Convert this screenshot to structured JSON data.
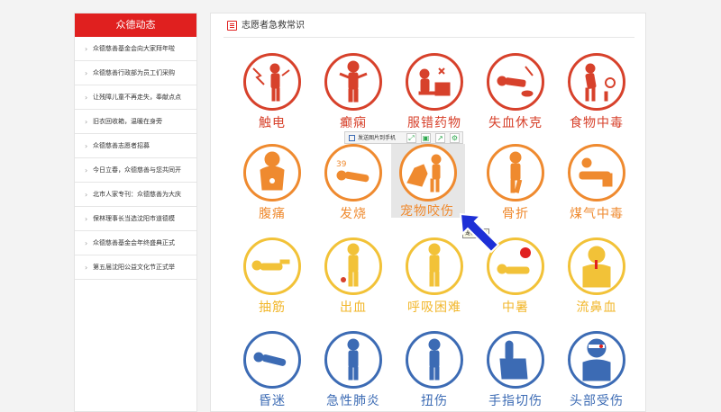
{
  "sidebar": {
    "title": "众德动态",
    "items": [
      {
        "label": "众德慈善基金会向大家拜年啦"
      },
      {
        "label": "众德慈善行政部为员工们采购"
      },
      {
        "label": "让残障儿童不再走失，奉献点点"
      },
      {
        "label": "旧衣回收箱，温暖在身旁"
      },
      {
        "label": "众德慈善志愿者招募"
      },
      {
        "label": "今日立春，众德慈善与您共同开"
      },
      {
        "label": "北市人家专刊：众德慈善为大庆"
      },
      {
        "label": "保林理事长当选沈阳市道德模"
      },
      {
        "label": "众德慈善基金会年终盛典正式"
      },
      {
        "label": "第五届沈阳公益文化节正式举"
      }
    ]
  },
  "main": {
    "title": "志愿者急救常识",
    "tiles": [
      {
        "label": "触电",
        "color": "#d7412b",
        "icon": "electric-shock-icon"
      },
      {
        "label": "癫痫",
        "color": "#d7412b",
        "icon": "epilepsy-icon"
      },
      {
        "label": "服错药物",
        "color": "#d7412b",
        "icon": "wrong-medicine-icon"
      },
      {
        "label": "失血休克",
        "color": "#d7412b",
        "icon": "blood-loss-shock-icon"
      },
      {
        "label": "食物中毒",
        "color": "#d7412b",
        "icon": "food-poisoning-icon"
      },
      {
        "label": "腹痛",
        "color": "#ef8a2f",
        "icon": "abdominal-pain-icon"
      },
      {
        "label": "发烧",
        "color": "#ef8a2f",
        "icon": "fever-icon"
      },
      {
        "label": "宠物咬伤",
        "color": "#ef8a2f",
        "icon": "pet-bite-icon"
      },
      {
        "label": "骨折",
        "color": "#ef8a2f",
        "icon": "fracture-icon"
      },
      {
        "label": "煤气中毒",
        "color": "#ef8a2f",
        "icon": "gas-poisoning-icon"
      },
      {
        "label": "抽筋",
        "color": "#f2c238",
        "icon": "cramp-icon"
      },
      {
        "label": "出血",
        "color": "#f2c238",
        "icon": "bleeding-icon"
      },
      {
        "label": "呼吸困难",
        "color": "#f2c238",
        "icon": "breathing-difficulty-icon"
      },
      {
        "label": "中暑",
        "color": "#f2c238",
        "icon": "heatstroke-icon"
      },
      {
        "label": "流鼻血",
        "color": "#f2c238",
        "icon": "nosebleed-icon"
      },
      {
        "label": "昏迷",
        "color": "#3c6bb4",
        "icon": "coma-icon"
      },
      {
        "label": "急性肺炎",
        "color": "#3c6bb4",
        "icon": "acute-pneumonia-icon"
      },
      {
        "label": "扭伤",
        "color": "#3c6bb4",
        "icon": "sprain-icon"
      },
      {
        "label": "手指切伤",
        "color": "#3c6bb4",
        "icon": "finger-cut-icon"
      },
      {
        "label": "头部受伤",
        "color": "#3c6bb4",
        "icon": "head-injury-icon"
      }
    ]
  },
  "fever_badge": "39",
  "toolbar": {
    "send_label": "发送图片到手机",
    "buttons": [
      "expand-icon",
      "save-icon",
      "share-icon",
      "settings-icon"
    ]
  },
  "tooltip": {
    "text": "宠物咬伤"
  },
  "colors": {
    "accent": "#e0201f",
    "cursor": "#1d2fd6"
  }
}
